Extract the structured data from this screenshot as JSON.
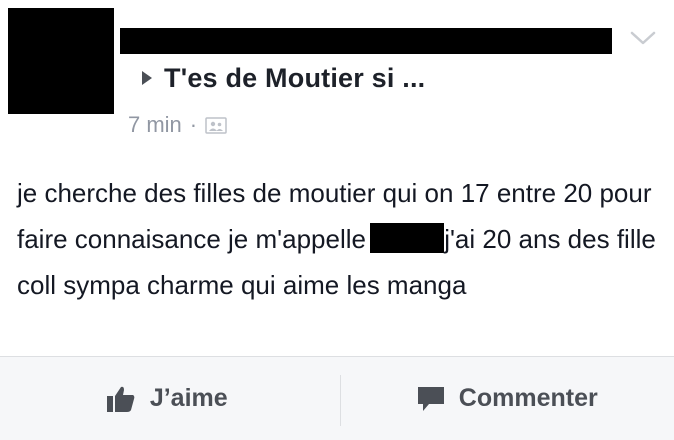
{
  "post": {
    "group_name": "T'es de Moutier si ...",
    "timestamp": "7 min",
    "separator": "·",
    "privacy_icon": "group-privacy-icon",
    "text_before_redaction": "je cherche des filles de moutier qui on 17 entre 20 pour faire connaisance je m'appelle ",
    "text_after_redaction": "j'ai 20 ans des fille coll sympa charme qui aime les manga"
  },
  "actions": {
    "like_label": "J’aime",
    "comment_label": "Commenter"
  },
  "colors": {
    "text": "#141823",
    "muted": "#9197a3",
    "action_text": "#4b4f56",
    "action_bar_bg": "#f6f7f9",
    "divider": "#dddfe2"
  }
}
